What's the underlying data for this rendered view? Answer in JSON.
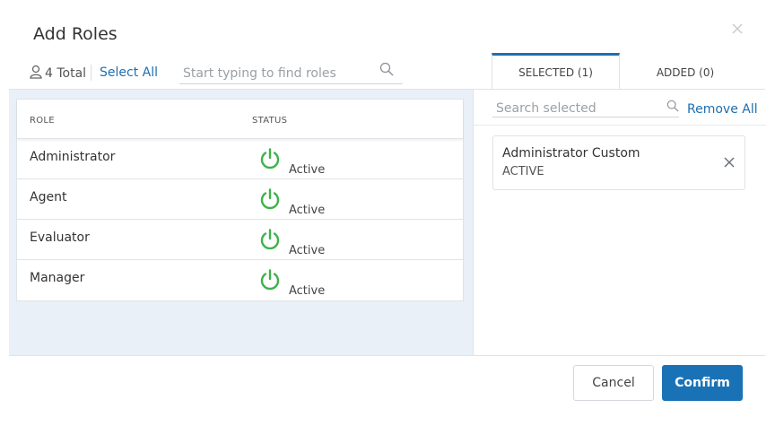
{
  "dialog": {
    "title": "Add Roles",
    "close_icon": "close-icon"
  },
  "toolbar": {
    "total_icon": "user-icon",
    "total_label": "4 Total",
    "select_all_label": "Select All",
    "search_placeholder": "Start typing to find roles",
    "search_icon": "search-icon"
  },
  "tabs": [
    {
      "label": "SELECTED (1)",
      "active": true
    },
    {
      "label": "ADDED (0)",
      "active": false
    }
  ],
  "table": {
    "columns": [
      "ROLE",
      "STATUS"
    ],
    "rows": [
      {
        "role": "Administrator",
        "status": "Active",
        "status_icon": "power-icon"
      },
      {
        "role": "Agent",
        "status": "Active",
        "status_icon": "power-icon"
      },
      {
        "role": "Evaluator",
        "status": "Active",
        "status_icon": "power-icon"
      },
      {
        "role": "Manager",
        "status": "Active",
        "status_icon": "power-icon"
      }
    ]
  },
  "selected_panel": {
    "search_placeholder": "Search selected",
    "search_icon": "search-icon",
    "remove_all_label": "Remove All",
    "items": [
      {
        "name": "Administrator Custom",
        "state": "ACTIVE",
        "remove_icon": "close-icon"
      }
    ]
  },
  "footer": {
    "cancel_label": "Cancel",
    "confirm_label": "Confirm"
  },
  "colors": {
    "accent": "#1e6fb0",
    "confirm_bg": "#1a72b6",
    "status_active": "#3cb34a",
    "left_pane_bg": "#e9f0f7"
  }
}
